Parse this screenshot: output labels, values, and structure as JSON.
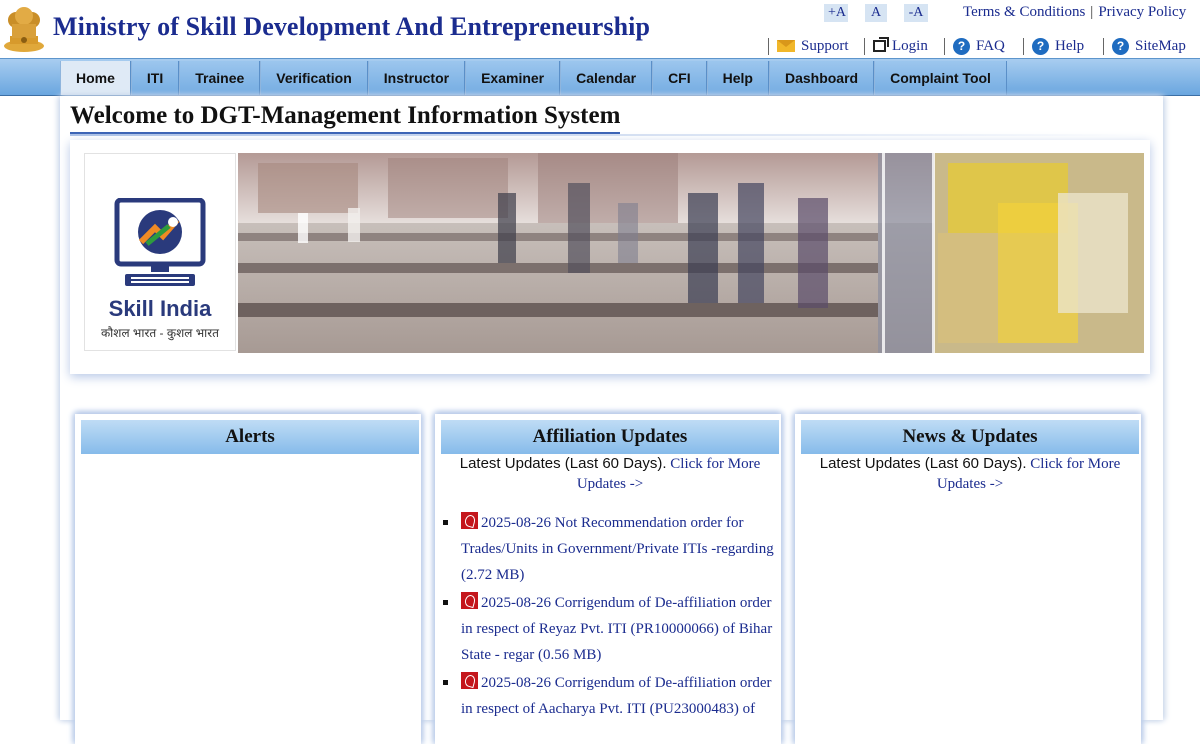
{
  "header": {
    "title": "Ministry of Skill Development And Entrepreneurship",
    "font_sizes": [
      "+A",
      "A",
      "-A"
    ],
    "top_links": [
      "Terms & Conditions",
      "Privacy Policy"
    ],
    "utility_links": [
      {
        "label": "Support",
        "icon": "mail-icon"
      },
      {
        "label": "Login",
        "icon": "external-link-icon"
      },
      {
        "label": "FAQ",
        "icon": "question-icon"
      },
      {
        "label": "Help",
        "icon": "question-icon"
      },
      {
        "label": "SiteMap",
        "icon": "question-icon"
      }
    ]
  },
  "nav": {
    "items": [
      "Home",
      "ITI",
      "Trainee",
      "Verification",
      "Instructor",
      "Examiner",
      "Calendar",
      "CFI",
      "Help",
      "Dashboard",
      "Complaint Tool"
    ],
    "active": "Home"
  },
  "main": {
    "welcome": "Welcome to DGT-Management Information System",
    "logo": {
      "brand": "Skill India",
      "tagline": "कौशल भारत - कुशल भारत"
    }
  },
  "panels": {
    "alerts": {
      "title": "Alerts"
    },
    "affiliation": {
      "title": "Affiliation Updates",
      "latest_text": "Latest Updates (Last 60 Days).",
      "more_link": "Click for More Updates ->",
      "items": [
        "2025-08-26 Not Recommendation order for Trades/Units in Government/Private ITIs -regarding (2.72 MB)",
        "2025-08-26 Corrigendum of De-affiliation order in respect of Reyaz Pvt. ITI (PR10000066) of Bihar State - regar (0.56 MB)",
        "2025-08-26 Corrigendum of De-affiliation order in respect of Aacharya Pvt. ITI (PU23000483) of"
      ]
    },
    "news": {
      "title": "News & Updates",
      "latest_text": "Latest Updates (Last 60 Days).",
      "more_link": "Click for More Updates ->"
    }
  },
  "colors": {
    "brand_blue": "#1b2c8f",
    "nav_blue": "#7db4e6",
    "pdf_red": "#c4161c"
  }
}
